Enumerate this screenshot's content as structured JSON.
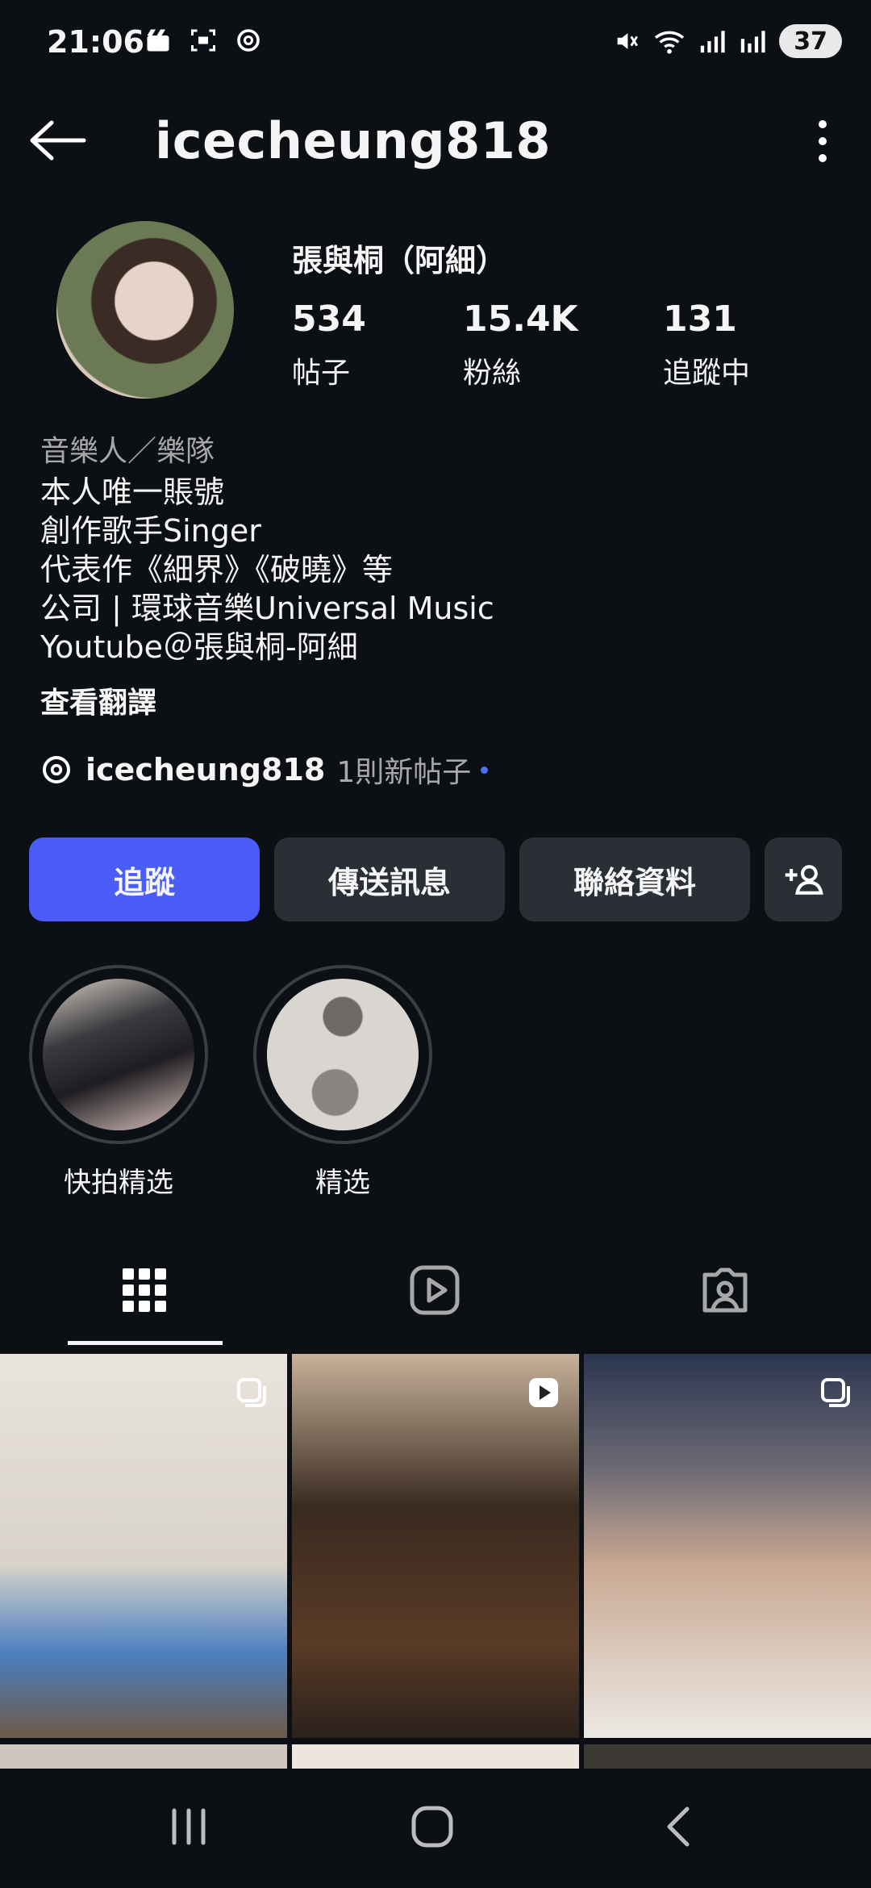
{
  "status_bar": {
    "time": "21:06",
    "battery": "37"
  },
  "header": {
    "username": "icecheung818"
  },
  "profile": {
    "display_name": "張與桐（阿細）",
    "stats": [
      {
        "value": "534",
        "label": "帖子"
      },
      {
        "value": "15.4K",
        "label": "粉絲"
      },
      {
        "value": "131",
        "label": "追蹤中"
      }
    ],
    "category": "音樂人／樂隊",
    "bio_lines": [
      "本人唯一賬號",
      "創作歌手Singer",
      "代表作《細界》《破曉》等",
      "公司 | 環球音樂Universal Music",
      "Youtube＠張與桐-阿細"
    ],
    "see_translation": "查看翻譯",
    "threads": {
      "handle": "icecheung818",
      "new_posts": "1則新帖子"
    }
  },
  "buttons": {
    "follow": "追蹤",
    "message": "傳送訊息",
    "contact": "聯絡資料"
  },
  "highlights": [
    {
      "label": "快拍精选"
    },
    {
      "label": "精选"
    }
  ],
  "colors": {
    "background": "#0c1014",
    "accent": "#4a5df9",
    "secondary_button": "#2a2f35"
  }
}
